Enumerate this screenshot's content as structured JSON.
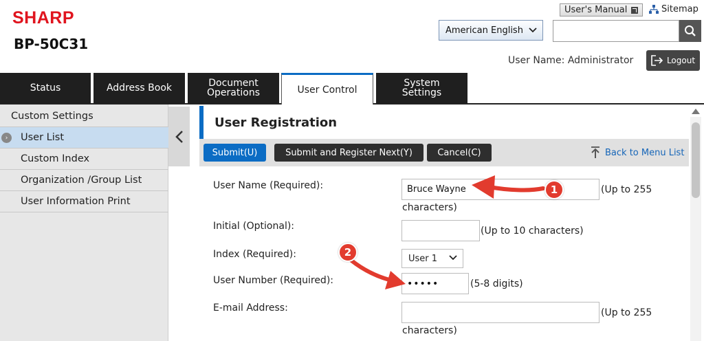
{
  "header": {
    "brand": "SHARP",
    "model": "BP-50C31",
    "manual_label": "User's Manual",
    "sitemap_label": "Sitemap",
    "language": "American English",
    "search_placeholder": "",
    "user_name": "User Name: Administrator",
    "logout_label": "Logout"
  },
  "tabs": [
    {
      "label": "Status"
    },
    {
      "label": "Address Book"
    },
    {
      "label": "Document\nOperations"
    },
    {
      "label": "User Control"
    },
    {
      "label": "System\nSettings"
    }
  ],
  "sidebar": {
    "header": "Custom Settings",
    "items": [
      {
        "label": "User List"
      },
      {
        "label": "Custom Index"
      },
      {
        "label": "Organization /Group List"
      },
      {
        "label": "User Information Print"
      }
    ]
  },
  "main": {
    "title": "User Registration",
    "buttons": {
      "submit": "Submit(U)",
      "submit_next": "Submit and Register Next(Y)",
      "cancel": "Cancel(C)"
    },
    "back_link": "Back to Menu List",
    "fields": {
      "user_name": {
        "label": "User Name (Required):",
        "value": "Bruce Wayne",
        "hint_a": "(Up to 255",
        "hint_b": "characters)"
      },
      "initial": {
        "label": "Initial (Optional):",
        "value": "",
        "hint": "(Up to 10 characters)"
      },
      "index": {
        "label": "Index (Required):",
        "value": "User 1"
      },
      "user_number": {
        "label": "User Number (Required):",
        "value": "•••••",
        "hint": "(5-8 digits)"
      },
      "email": {
        "label": "E-mail Address:",
        "value": "",
        "hint_a": "(Up to 255",
        "hint_b": "characters)"
      }
    }
  },
  "annotations": [
    {
      "number": "1"
    },
    {
      "number": "2"
    }
  ],
  "colors": {
    "brand": "#e0141e",
    "accent": "#0b6cc4",
    "annotation": "#e23b2e"
  }
}
